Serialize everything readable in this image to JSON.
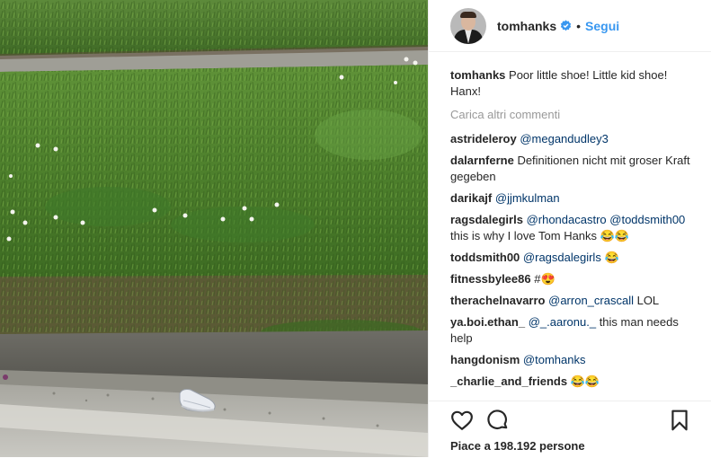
{
  "post": {
    "author": "tomhanks",
    "follow_label": "Segui",
    "separator": "•",
    "caption": {
      "user": "tomhanks",
      "text": "Poor little shoe! Little kid shoe! Hanx!"
    },
    "load_more_label": "Carica altri commenti",
    "comments": [
      {
        "user": "astrideleroy",
        "mention": "@megandudley3",
        "text": ""
      },
      {
        "user": "dalarnferne",
        "mention": "",
        "text": "Definitionen nicht mit groser Kraft gegeben"
      },
      {
        "user": "darikajf",
        "mention": "@jjmkulman",
        "text": ""
      },
      {
        "user": "ragsdalegirls",
        "mention": "@rhondacastro",
        "mention2": "@toddsmith00",
        "text": "this is why I love Tom Hanks",
        "emoji": "😂😂"
      },
      {
        "user": "toddsmith00",
        "mention": "@ragsdalegirls",
        "text": "😂"
      },
      {
        "user": "fitnessbylee86",
        "mention": "",
        "text": "#😍"
      },
      {
        "user": "therachelnavarro",
        "mention": "@arron_crascall",
        "text": "LOL"
      },
      {
        "user": "ya.boi.ethan_",
        "mention": "@_.aaronu._",
        "text": "this man needs help"
      },
      {
        "user": "hangdonism",
        "mention": "@tomhanks",
        "text": ""
      },
      {
        "user": "_charlie_and_friends",
        "mention": "",
        "text": "😂😂"
      }
    ],
    "likes_text": "Piace a 198.192 persone",
    "icons": {
      "like": "heart-icon",
      "comment": "comment-bubble-icon",
      "save": "bookmark-icon",
      "verified": "verified-badge-icon"
    },
    "colors": {
      "accent": "#3897f0",
      "mention": "#003569",
      "muted": "#999999"
    }
  }
}
